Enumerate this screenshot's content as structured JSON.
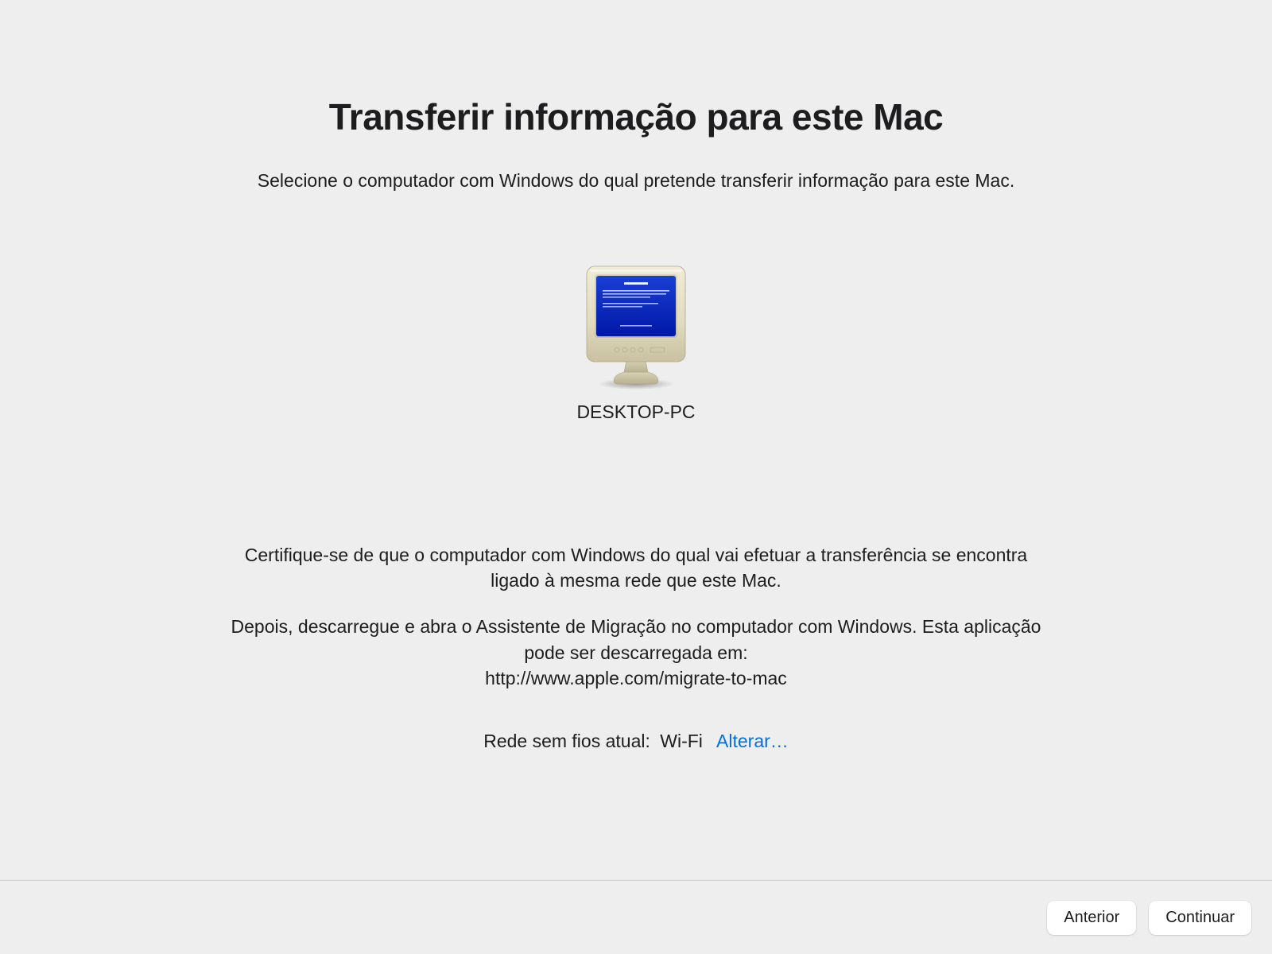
{
  "title": "Transferir informação para este Mac",
  "subtitle": "Selecione o computador com Windows do qual pretende transferir informação para este Mac.",
  "source": {
    "name": "DESKTOP-PC",
    "icon": "crt-pc-icon"
  },
  "info": {
    "line1": "Certifique-se de que o computador com Windows do qual vai efetuar a transferência se encontra ligado à mesma rede que este Mac.",
    "line2a": "Depois, descarregue e abra o Assistente de Migração no computador com Windows. Esta aplicação pode ser descarregada em:",
    "line2b": "http://www.apple.com/migrate-to-mac"
  },
  "network": {
    "label": "Rede sem fios atual:",
    "name": "Wi-Fi",
    "change_label": "Alterar…"
  },
  "buttons": {
    "back": "Anterior",
    "continue": "Continuar"
  }
}
